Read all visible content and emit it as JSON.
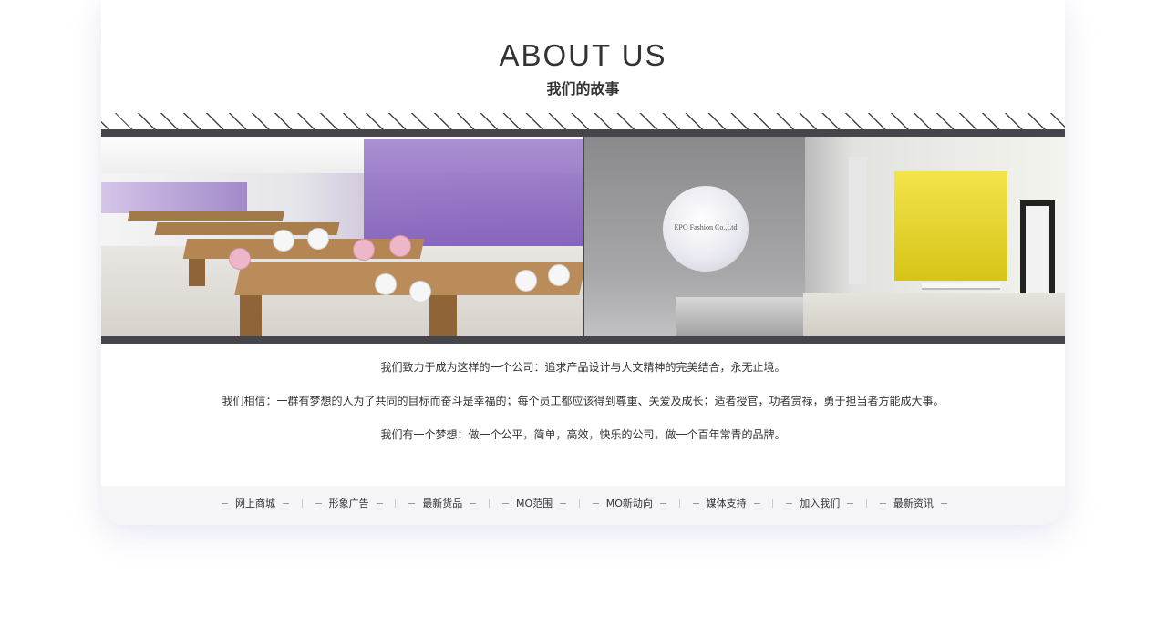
{
  "header": {
    "title": "ABOUT US",
    "subtitle": "我们的故事"
  },
  "gallery": {
    "right_photo_sign": "EPO Fashion Co.,Ltd."
  },
  "intro": {
    "paragraphs": [
      "我们致力于成为这样的一个公司：追求产品设计与人文精神的完美结合，永无止境。",
      "我们相信：一群有梦想的人为了共同的目标而奋斗是幸福的；每个员工都应该得到尊重、关爱及成长；适者授官，功者赏禄，勇于担当者方能成大事。",
      "我们有一个梦想：做一个公平，简单，高效，快乐的公司，做一个百年常青的品牌。"
    ]
  },
  "footer_nav": {
    "items": [
      {
        "label": "网上商城"
      },
      {
        "label": "形象广告"
      },
      {
        "label": "最新货品"
      },
      {
        "label": "MO范围"
      },
      {
        "label": "MO新动向"
      },
      {
        "label": "媒体支持"
      },
      {
        "label": "加入我们"
      },
      {
        "label": "最新资讯"
      }
    ]
  },
  "colors": {
    "band": "#45454b",
    "text": "#333333",
    "footer_bg": "#f5f5f8",
    "accent_purple": "#7a54b6",
    "accent_yellow": "#f2e44a"
  }
}
